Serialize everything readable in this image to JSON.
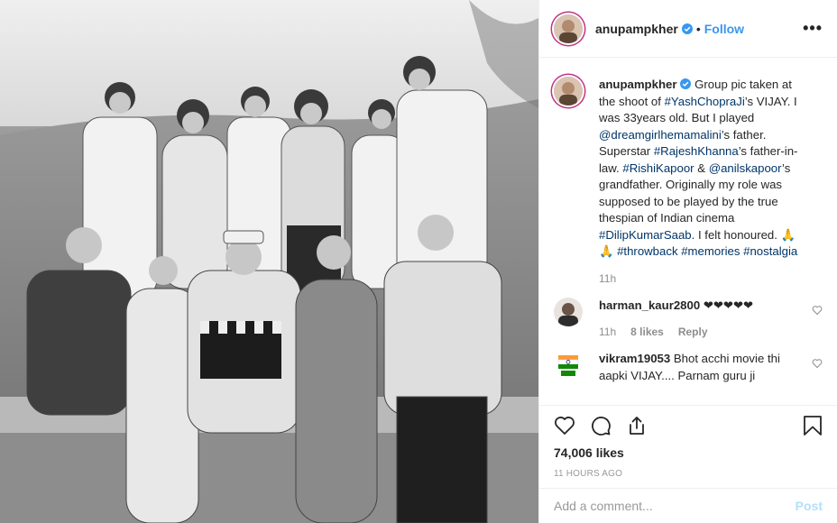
{
  "post": {
    "username": "anupampkher",
    "follow_label": "Follow",
    "dot": "•",
    "more_label": "•••",
    "verified_icon": "verified-badge-icon",
    "accent": "#3897f0"
  },
  "caption": {
    "username": "anupampkher",
    "t1": " Group pic taken at the shoot of ",
    "tag1": "#YashChopraJi",
    "t2": "’s VIJAY. I was 33years old. But I played ",
    "mention1": "@dreamgirlhemamalini",
    "t3": "’s father. Superstar ",
    "tag2": "#RajeshKhanna",
    "t4": "’s father-in-law. ",
    "tag3": "#RishiKapoor",
    "t5": " & ",
    "mention2": "@anilskapoor",
    "t6": "’s grandfather. Originally my role was supposed to be played by the true thespian of Indian cinema ",
    "tag4": "#DilipKumarSaab",
    "t7": ". I felt honoured. 🙏🙏 ",
    "tag5": "#throwback",
    "sp": " ",
    "tag6": "#memories",
    "tag7": "#nostalgia",
    "time": "11h"
  },
  "comments": [
    {
      "username": "harman_kaur2800",
      "text": " ❤❤❤❤❤",
      "time": "11h",
      "likes": "8 likes",
      "reply": "Reply"
    },
    {
      "username": "vikram19053",
      "text": " Bhot acchi movie thi aapki VIJAY.... Parnam guru ji"
    }
  ],
  "likes_count": "74,006 likes",
  "timestamp": "11 HOURS AGO",
  "add_comment": {
    "placeholder": "Add a comment...",
    "post_label": "Post"
  },
  "colors": {
    "link": "#003569",
    "muted": "#8e8e8e",
    "post_disabled": "#b2dffc",
    "story_ring": "#c13584"
  }
}
